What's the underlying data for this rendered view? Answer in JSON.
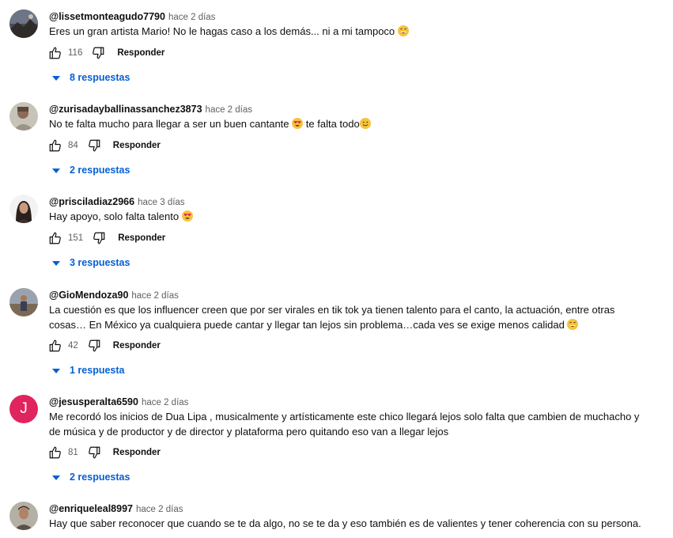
{
  "comments": [
    {
      "author": "@lissetmonteagudo7790",
      "time": "hace 2 días",
      "text": "Eres un gran artista Mario! No le hagas caso a los demás... ni a mi tampoco",
      "emoji": "grinning-sweat",
      "likes": "116",
      "reply_label": "Responder",
      "replies_label": "8 respuestas",
      "avatar": "landscape-photo"
    },
    {
      "author": "@zurisadayballinassanchez3873",
      "time": "hace 2 días",
      "text": "No te falta mucho para llegar a ser un buen cantante",
      "text2": "te falta todo",
      "emoji": "heart-eyes",
      "emoji2": "slight-smile",
      "likes": "84",
      "reply_label": "Responder",
      "replies_label": "2 respuestas",
      "avatar": "person-photo"
    },
    {
      "author": "@prisciladiaz2966",
      "time": "hace 3 días",
      "text": "Hay apoyo,  solo falta talento",
      "emoji": "heart-eyes",
      "likes": "151",
      "reply_label": "Responder",
      "replies_label": "3 respuestas",
      "avatar": "person-photo"
    },
    {
      "author": "@GioMendoza90",
      "time": "hace 2 días",
      "text": "La cuestión es que los influencer creen que por ser virales en tik tok ya tienen talento para el canto, la actuación, entre otras cosas… En México ya cualquiera puede cantar y llegar tan lejos sin problema…cada ves se exige menos calidad",
      "emoji": "grinning-sweat",
      "likes": "42",
      "reply_label": "Responder",
      "replies_label": "1 respuesta",
      "avatar": "outdoor-photo"
    },
    {
      "author": "@jesusperalta6590",
      "time": "hace 2 días",
      "text": "Me recordó los inicios de Dua Lipa , musicalmente y artísticamente este chico llegará lejos solo falta que cambien de muchacho y de música y de productor y de director y plataforma pero quitando eso van a llegar lejos",
      "likes": "81",
      "reply_label": "Responder",
      "replies_label": "2 respuestas",
      "avatar_letter": "J",
      "avatar_color": "#e0245e"
    },
    {
      "author": "@enriqueleal8997",
      "time": "hace 2 días",
      "text": "Hay que saber reconocer que cuando se te da algo, no se te da y eso también es de valientes y tener coherencia con su persona.",
      "avatar": "person-photo"
    }
  ]
}
